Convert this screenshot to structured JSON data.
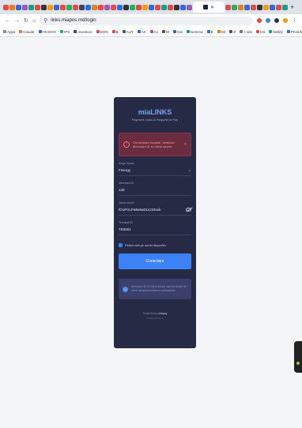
{
  "browser": {
    "url": "links.miapos.md/login",
    "bookmarks": [
      "Apps",
      "Claude",
      "HS-DOX",
      "IPS",
      "Investors",
      "DON",
      "B",
      "AUT",
      "AK",
      "A1",
      "M",
      "Cal",
      "Gemma",
      "B",
      "Git",
      "Z",
      "< site",
      "HS",
      "Netlify",
      "PhotoMagic",
      "All Bookmarks"
    ]
  },
  "login": {
    "title": "miaLINKS",
    "subtitle": "Payment Links & Request to Pay",
    "alert": {
      "text": "Credentiale invalide. Verificati Merchant ID si Client secret.",
      "close": "×"
    },
    "fields": {
      "region_label": "Alege banca",
      "region_value": "Finergy",
      "merchant_label": "Merchant ID",
      "merchant_value": "128",
      "secret_label": "Client secret",
      "secret_value": "fOoiPzLPa9e6aDLiU33oxk",
      "terminal_label": "Terminal ID",
      "terminal_value": "TE0001"
    },
    "remember_label": "Retine-mă pe acest dispozitiv",
    "submit_label": "Conectare",
    "info_text": "Merchant ID și Client secret sunt furnizate de către bancă la emiterea contractului.",
    "footer_powered": "Powered by",
    "footer_brand": "miapay",
    "footer_by": "Finergy Tech srl"
  },
  "colors": {
    "accent": "#3b82f6",
    "card": "#272a45",
    "alert_bg": "#6a2c3f"
  }
}
